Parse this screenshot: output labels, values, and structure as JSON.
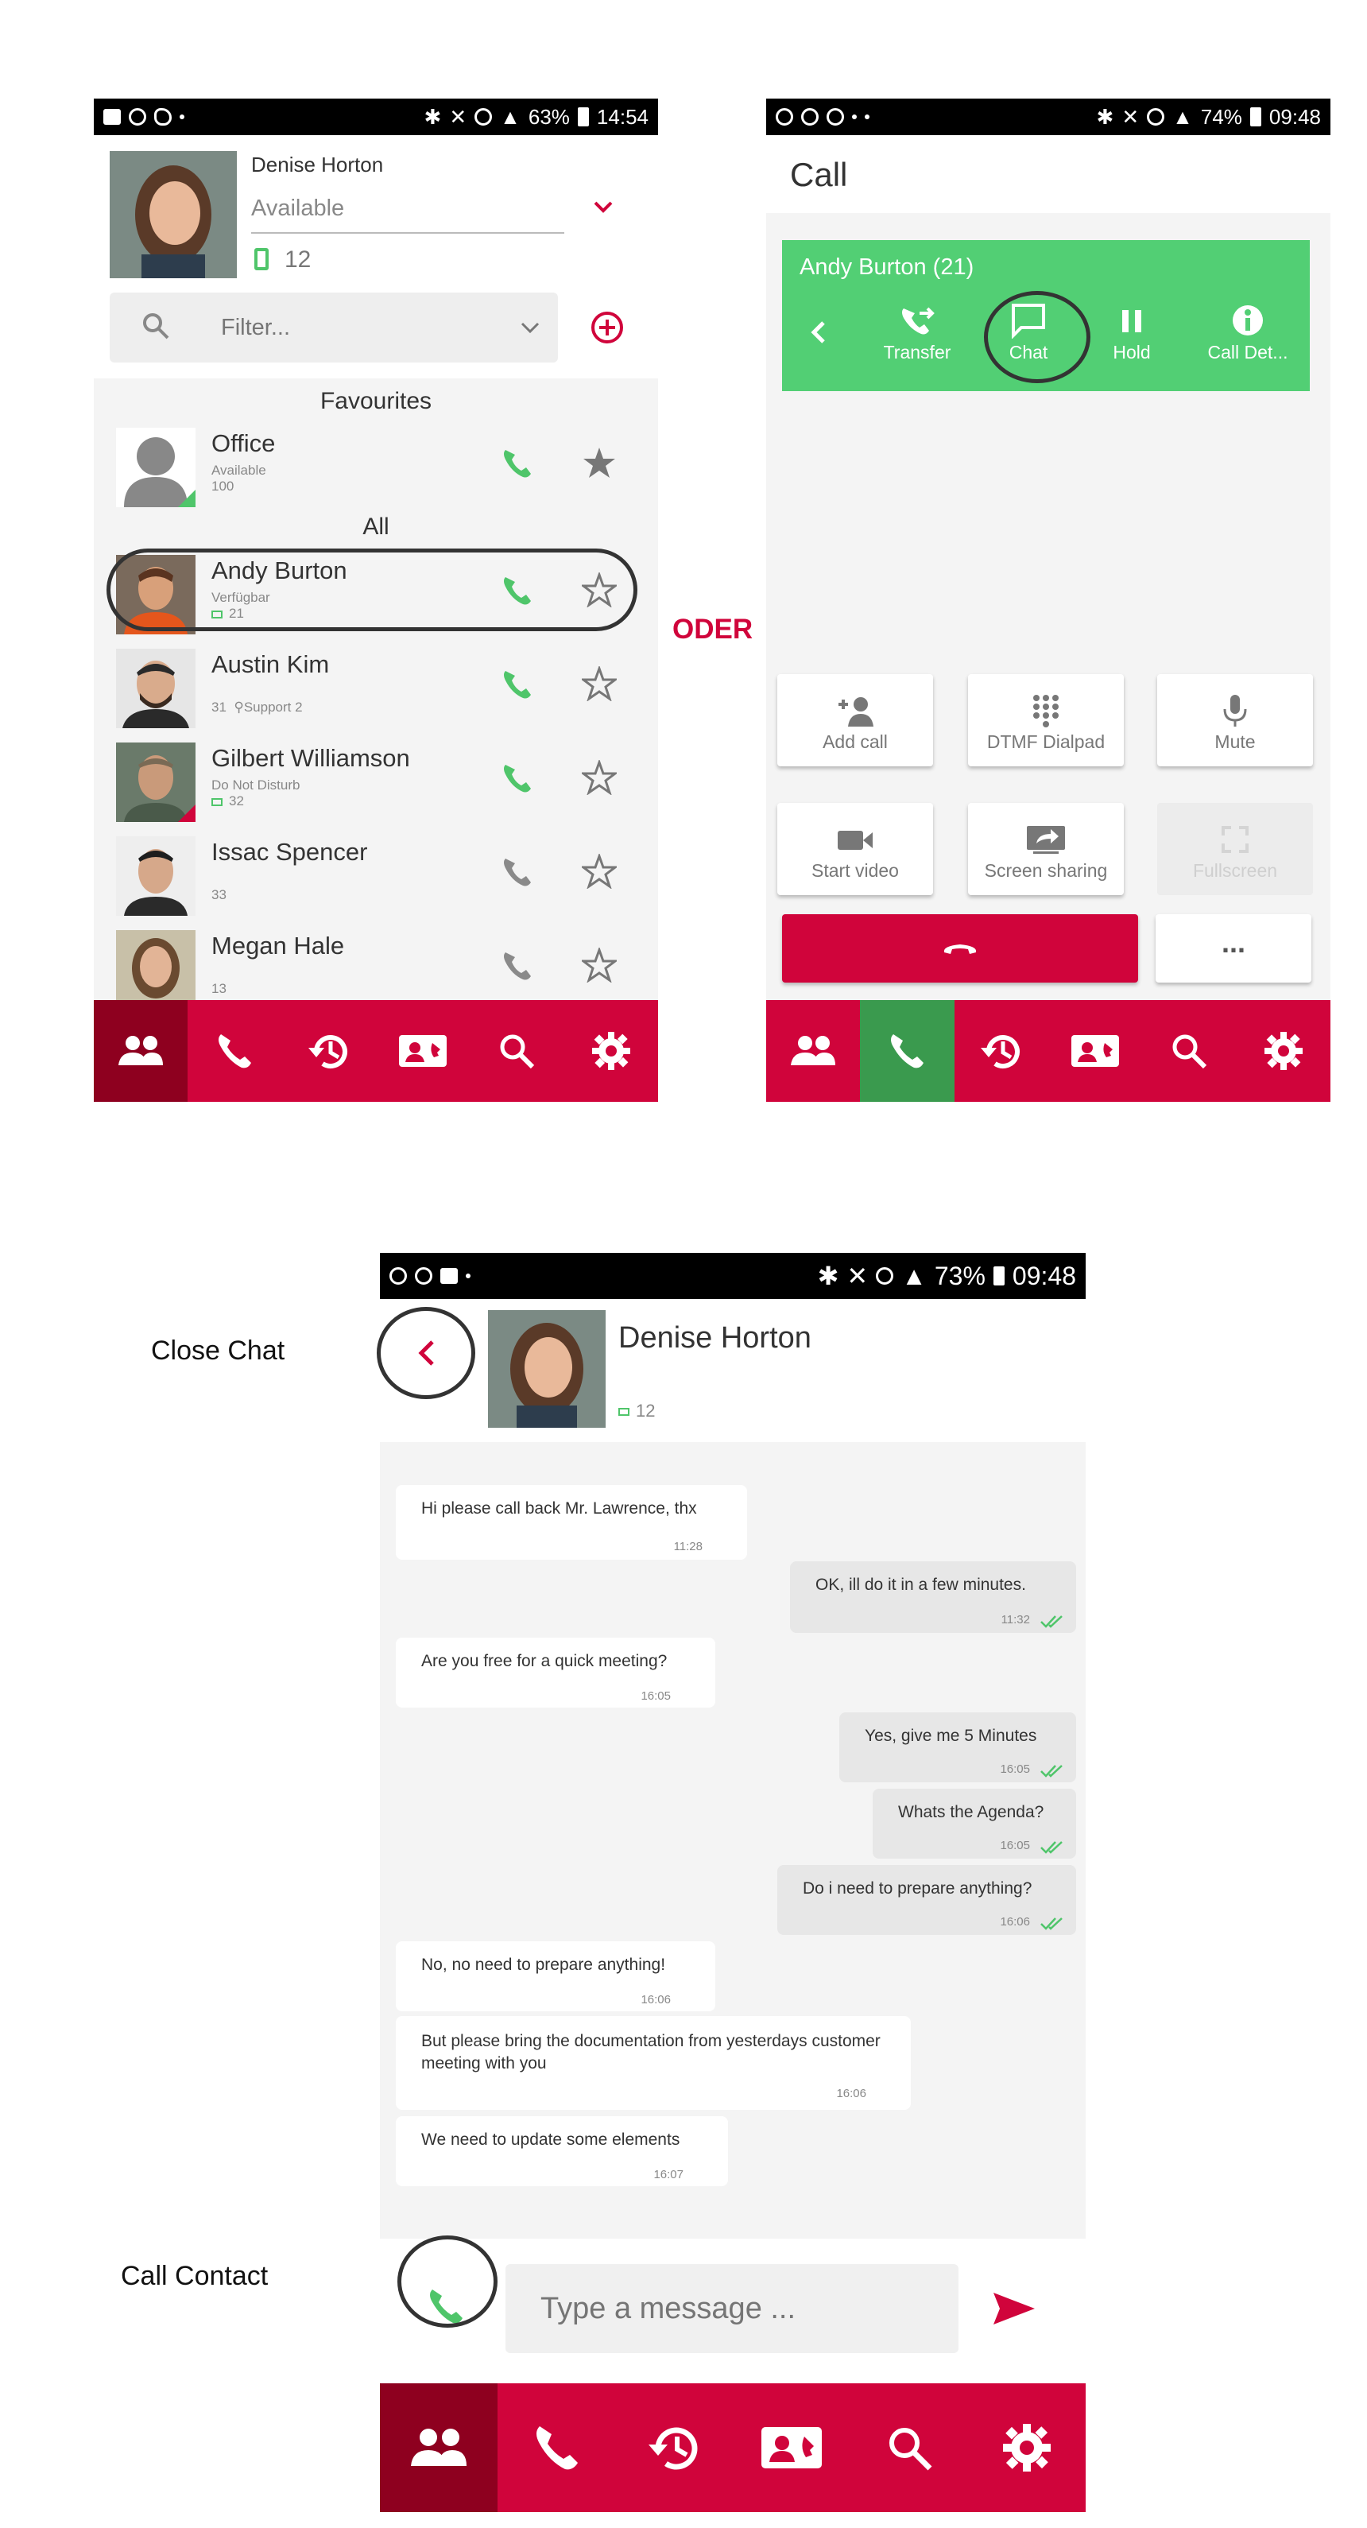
{
  "separator": "ODER",
  "screen1": {
    "status": {
      "left_icons": [
        "image-icon",
        "messenger-icon",
        "twitter-icon"
      ],
      "battery": "63%",
      "time": "14:54"
    },
    "user": {
      "name": "Denise Horton",
      "status": "Available",
      "extension": "12"
    },
    "filter": {
      "placeholder": "Filter..."
    },
    "sections": {
      "favourites": "Favourites",
      "all": "All"
    },
    "favourites": [
      {
        "name": "Office",
        "status": "Available",
        "ext": "100",
        "starred": true
      }
    ],
    "contacts": [
      {
        "name": "Andy Burton",
        "status": "Verfügbar",
        "ext": "21",
        "phone_color": "#4fc56a"
      },
      {
        "name": "Austin Kim",
        "status": "",
        "ext": "31",
        "location": "Support 2",
        "phone_color": "#4fc56a"
      },
      {
        "name": "Gilbert Williamson",
        "status": "Do Not Disturb",
        "ext": "32",
        "phone_color": "#4fc56a"
      },
      {
        "name": "Issac Spencer",
        "status": "",
        "ext": "33",
        "phone_color": "#8a8a8a"
      },
      {
        "name": "Megan Hale",
        "status": "",
        "ext": "13",
        "phone_color": "#8a8a8a"
      }
    ]
  },
  "screen2": {
    "status": {
      "battery": "74%",
      "time": "09:48"
    },
    "title": "Call",
    "call": {
      "caller": "Andy Burton (21)",
      "controls": [
        "Transfer",
        "Chat",
        "Hold",
        "Call Det..."
      ]
    },
    "tiles": [
      {
        "label": "Add call",
        "icon": "add-person-icon",
        "enabled": true
      },
      {
        "label": "DTMF Dialpad",
        "icon": "dialpad-icon",
        "enabled": true
      },
      {
        "label": "Mute",
        "icon": "microphone-icon",
        "enabled": true
      },
      {
        "label": "Start video",
        "icon": "video-icon",
        "enabled": true
      },
      {
        "label": "Screen sharing",
        "icon": "screen-share-icon",
        "enabled": true
      },
      {
        "label": "Fullscreen",
        "icon": "fullscreen-icon",
        "enabled": false
      }
    ],
    "more": "..."
  },
  "screen3": {
    "status": {
      "battery": "73%",
      "time": "09:48"
    },
    "contact": {
      "name": "Denise Horton",
      "extension": "12"
    },
    "annotations": {
      "close_chat": "Close Chat",
      "call_contact": "Call Contact"
    },
    "messages": [
      {
        "dir": "in",
        "text": "Hi please call back Mr. Lawrence, thx",
        "time": "11:28"
      },
      {
        "dir": "out",
        "text": "OK, ill do it in a few minutes.",
        "time": "11:32"
      },
      {
        "dir": "in",
        "text": "Are you free for a quick meeting?",
        "time": "16:05"
      },
      {
        "dir": "out",
        "text": "Yes, give me 5 Minutes",
        "time": "16:05"
      },
      {
        "dir": "out",
        "text": "Whats the Agenda?",
        "time": "16:05"
      },
      {
        "dir": "out",
        "text": "Do i need to prepare anything?",
        "time": "16:06"
      },
      {
        "dir": "in",
        "text": "No, no need to prepare anything!",
        "time": "16:06"
      },
      {
        "dir": "in",
        "text": "But please bring the documentation from yesterdays customer meeting with you",
        "time": "16:06"
      },
      {
        "dir": "in",
        "text": "We need to update some elements",
        "time": "16:07"
      }
    ],
    "input": {
      "placeholder": "Type a message ..."
    }
  },
  "nav_items": [
    "contacts-icon",
    "phone-icon",
    "history-icon",
    "contact-card-icon",
    "search-icon",
    "settings-icon"
  ],
  "colors": {
    "brand": "#d0043b",
    "brand_dark": "#8e001f",
    "green": "#52cf74",
    "phone_green": "#4fc56a"
  }
}
